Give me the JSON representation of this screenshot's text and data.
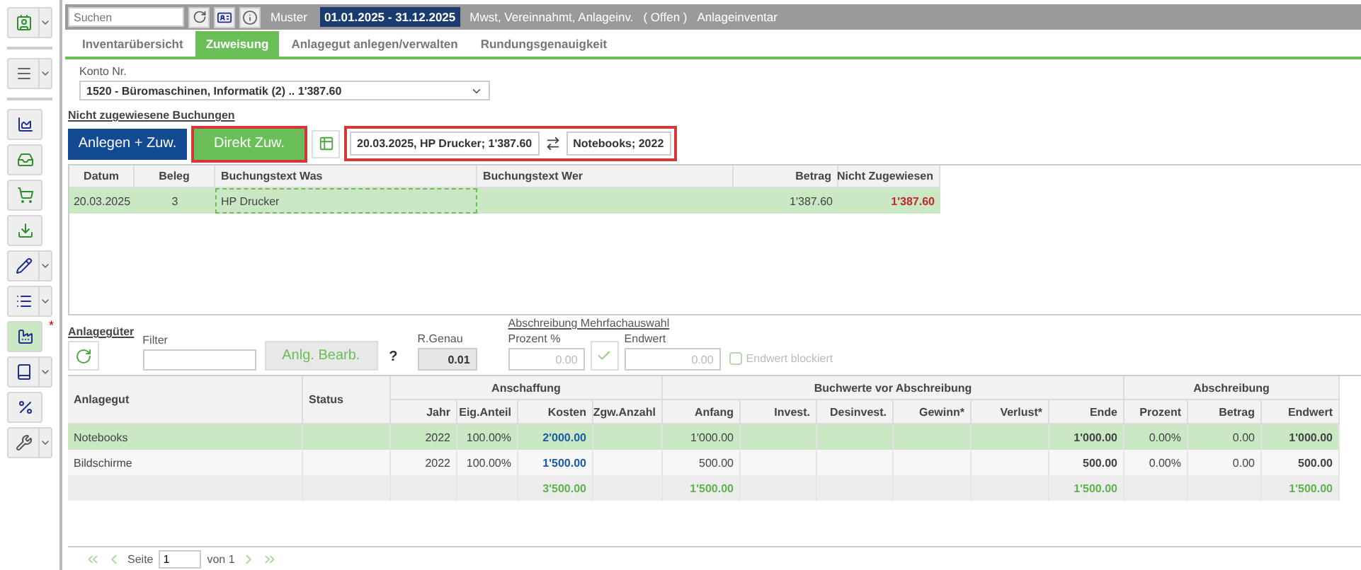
{
  "sidebar": [
    {
      "dropdown": true,
      "selected": false
    },
    {
      "dropdown": true,
      "selected": false
    },
    {
      "dropdown": false,
      "selected": false
    },
    {
      "dropdown": false,
      "selected": false
    },
    {
      "dropdown": false,
      "selected": false
    },
    {
      "dropdown": false,
      "selected": false
    },
    {
      "dropdown": true,
      "selected": false
    },
    {
      "dropdown": true,
      "selected": false
    },
    {
      "dropdown": false,
      "selected": true,
      "badge": "*"
    },
    {
      "dropdown": true,
      "selected": false
    },
    {
      "dropdown": false,
      "selected": false
    },
    {
      "dropdown": true,
      "selected": false
    }
  ],
  "topbar": {
    "search_placeholder": "Suchen",
    "client": "Muster",
    "period": "01.01.2025 - 31.12.2025",
    "settings": "Mwst, Vereinnahmt, Anlageinv.",
    "status": "( Offen )",
    "module": "Anlageinventar"
  },
  "tabs": [
    {
      "label": "Inventarübersicht",
      "selected": false
    },
    {
      "label": "Zuweisung",
      "selected": true
    },
    {
      "label": "Anlagegut anlegen/verwalten",
      "selected": false
    },
    {
      "label": "Rundungsgenauigkeit",
      "selected": false
    }
  ],
  "account": {
    "label": "Konto Nr.",
    "value": "1520 - Büromaschinen, Informatik (2) .. 1'387.60"
  },
  "bookings": {
    "title": "Nicht zugewiesene Buchungen",
    "buttons": [
      {
        "label": "Anlegen + Zuw.",
        "kind": "primary",
        "highlighted": false
      },
      {
        "label": "Direkt Zuw.",
        "kind": "success",
        "highlighted": true
      }
    ],
    "assignment": {
      "booking": "20.03.2025, HP Drucker; 1'387.60",
      "asset": "Notebooks; 2022",
      "highlighted": true
    },
    "columns": [
      "Datum",
      "Beleg",
      "Buchungstext Was",
      "Buchungstext Wer",
      "Betrag",
      "Nicht Zugewiesen"
    ],
    "rows": [
      {
        "cells": [
          "20.03.2025",
          "3",
          "HP Drucker",
          null,
          "1'387.60",
          "1'387.60"
        ],
        "selected": true
      }
    ]
  },
  "assets": {
    "title": "Anlagegüter",
    "filter_label": "Filter",
    "edit_button": {
      "label": "Anlg. Bearb.",
      "disabled": true
    },
    "help": "?",
    "rounding_label": "R.Genau",
    "rounding": "0.01",
    "multi": {
      "title": "Abschreibung Mehrfachauswahl",
      "percent_label": "Prozent %",
      "percent": "0.00",
      "end_label": "Endwert",
      "end": "0.00",
      "blocked_label": "Endwert blockiert",
      "blocked": false
    },
    "lead_columns": [
      "Anlagegut",
      "Status"
    ],
    "column_groups": [
      {
        "label": "Anschaffung",
        "columns": [
          "Jahr",
          "Eig.Anteil",
          "Kosten",
          "Zgw.Anzahl"
        ]
      },
      {
        "label": "Buchwerte vor Abschreibung",
        "columns": [
          "Anfang",
          "Invest.",
          "Desinvest.",
          "Gewinn*",
          "Verlust*",
          "Ende"
        ]
      },
      {
        "label": "Abschreibung",
        "columns": [
          "Prozent",
          "Betrag",
          "Endwert"
        ]
      }
    ],
    "rows": [
      {
        "kind": "item",
        "selected": true,
        "cells": [
          "Notebooks",
          null,
          "2022",
          "100.00%",
          "2'000.00",
          null,
          "1'000.00",
          null,
          null,
          null,
          null,
          "1'000.00",
          "0.00%",
          "0.00",
          "1'000.00"
        ]
      },
      {
        "kind": "item",
        "selected": false,
        "cells": [
          "Bildschirme",
          null,
          "2022",
          "100.00%",
          "1'500.00",
          null,
          "500.00",
          null,
          null,
          null,
          null,
          "500.00",
          "0.00%",
          "0.00",
          "500.00"
        ]
      },
      {
        "kind": "total",
        "selected": false,
        "cells": [
          null,
          null,
          null,
          null,
          "3'500.00",
          null,
          "1'500.00",
          null,
          null,
          null,
          null,
          "1'500.00",
          null,
          null,
          "1'500.00"
        ]
      }
    ]
  },
  "pager": {
    "page_label": "Seite",
    "page": "1",
    "of": "von 1"
  }
}
